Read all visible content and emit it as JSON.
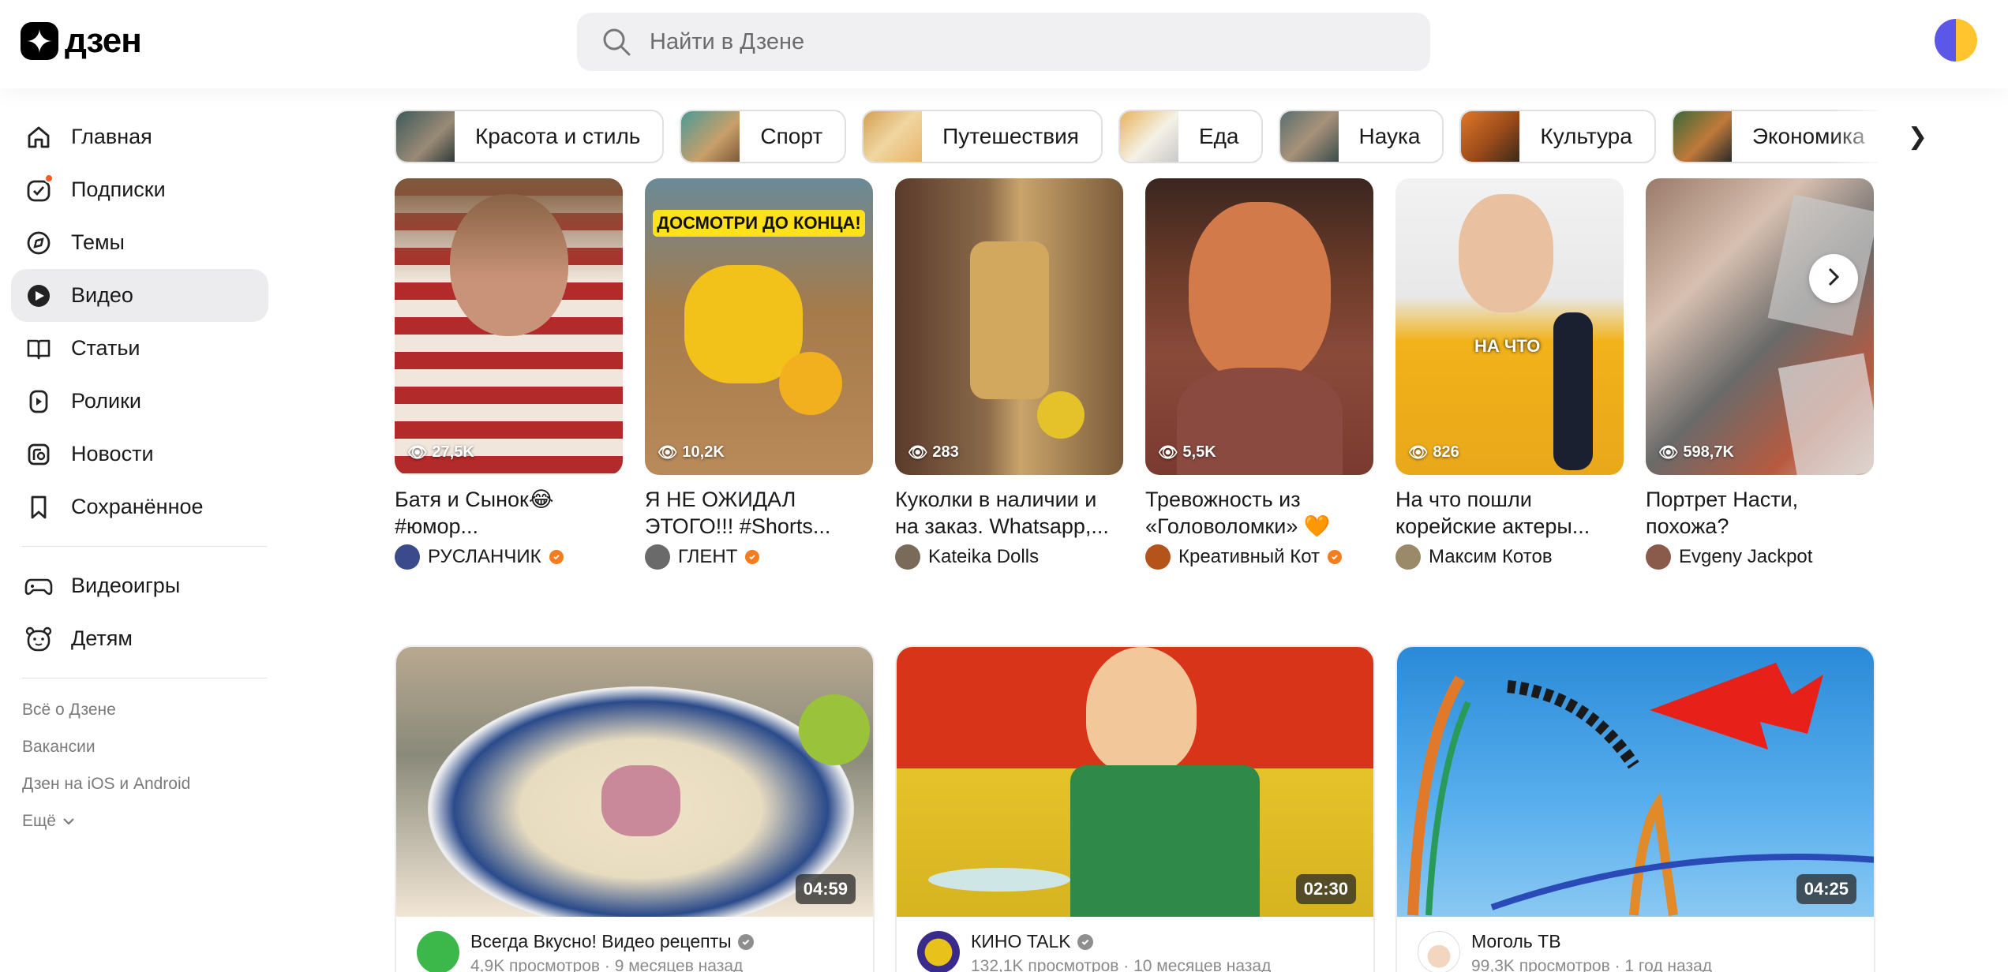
{
  "header": {
    "logo_text": "дзен",
    "search_placeholder": "Найти в Дзене"
  },
  "sidebar": {
    "items": [
      {
        "label": "Главная",
        "icon": "home-icon"
      },
      {
        "label": "Подписки",
        "icon": "subscriptions-icon"
      },
      {
        "label": "Темы",
        "icon": "compass-icon"
      },
      {
        "label": "Видео",
        "icon": "video-icon"
      },
      {
        "label": "Статьи",
        "icon": "article-icon"
      },
      {
        "label": "Ролики",
        "icon": "shorts-icon"
      },
      {
        "label": "Новости",
        "icon": "news-icon"
      },
      {
        "label": "Сохранённое",
        "icon": "bookmark-icon"
      }
    ],
    "extra": [
      {
        "label": "Видеоигры",
        "icon": "gamepad-icon"
      },
      {
        "label": "Детям",
        "icon": "kids-icon"
      }
    ],
    "footer": [
      "Всё о Дзене",
      "Вакансии",
      "Дзен на iOS и Android",
      "Ещё"
    ]
  },
  "chips": [
    "Красота и стиль",
    "Спорт",
    "Путешествия",
    "Еда",
    "Наука",
    "Культура",
    "Экономика"
  ],
  "shorts": [
    {
      "views": "27,5K",
      "title": "Батя и Сынок😂 #юмор...",
      "author": "РУСЛАНЧИК",
      "verified": true
    },
    {
      "views": "10,2K",
      "title": "Я НЕ ОЖИДАЛ ЭТОГО!!! #Shorts...",
      "author": "ГЛЕНТ",
      "verified": true,
      "overlay": "ДОСМОТРИ ДО КОНЦА!"
    },
    {
      "views": "283",
      "title": "Куколки в наличии и на заказ. Whatsapp,...",
      "author": "Kateika Dolls",
      "verified": false
    },
    {
      "views": "5,5K",
      "title": "Тревожность из «Головоломки» 🧡",
      "author": "Креативный Кот",
      "verified": true
    },
    {
      "views": "826",
      "title": "На что пошли корейские актеры...",
      "author": "Максим Котов",
      "verified": false,
      "overlay": "НА ЧТО"
    },
    {
      "views": "598,7K",
      "title": "Портрет Насти, похожа?",
      "author": "Evgeny Jackpot",
      "verified": false
    }
  ],
  "videos": [
    {
      "duration": "04:59",
      "channel": "Всегда Вкусно! Видео рецепты",
      "stats": "4,9K просмотров · 9 месяцев назад"
    },
    {
      "duration": "02:30",
      "channel": "КИНО TALK",
      "stats": "132,1K просмотров · 10 месяцев назад"
    },
    {
      "duration": "04:25",
      "channel": "Моголь ТВ",
      "stats": "99,3K просмотров · 1 год назад"
    }
  ],
  "colors": {
    "accent": "#f57c1f",
    "active_bg": "#ececee",
    "search_bg": "#f0f0f2"
  }
}
